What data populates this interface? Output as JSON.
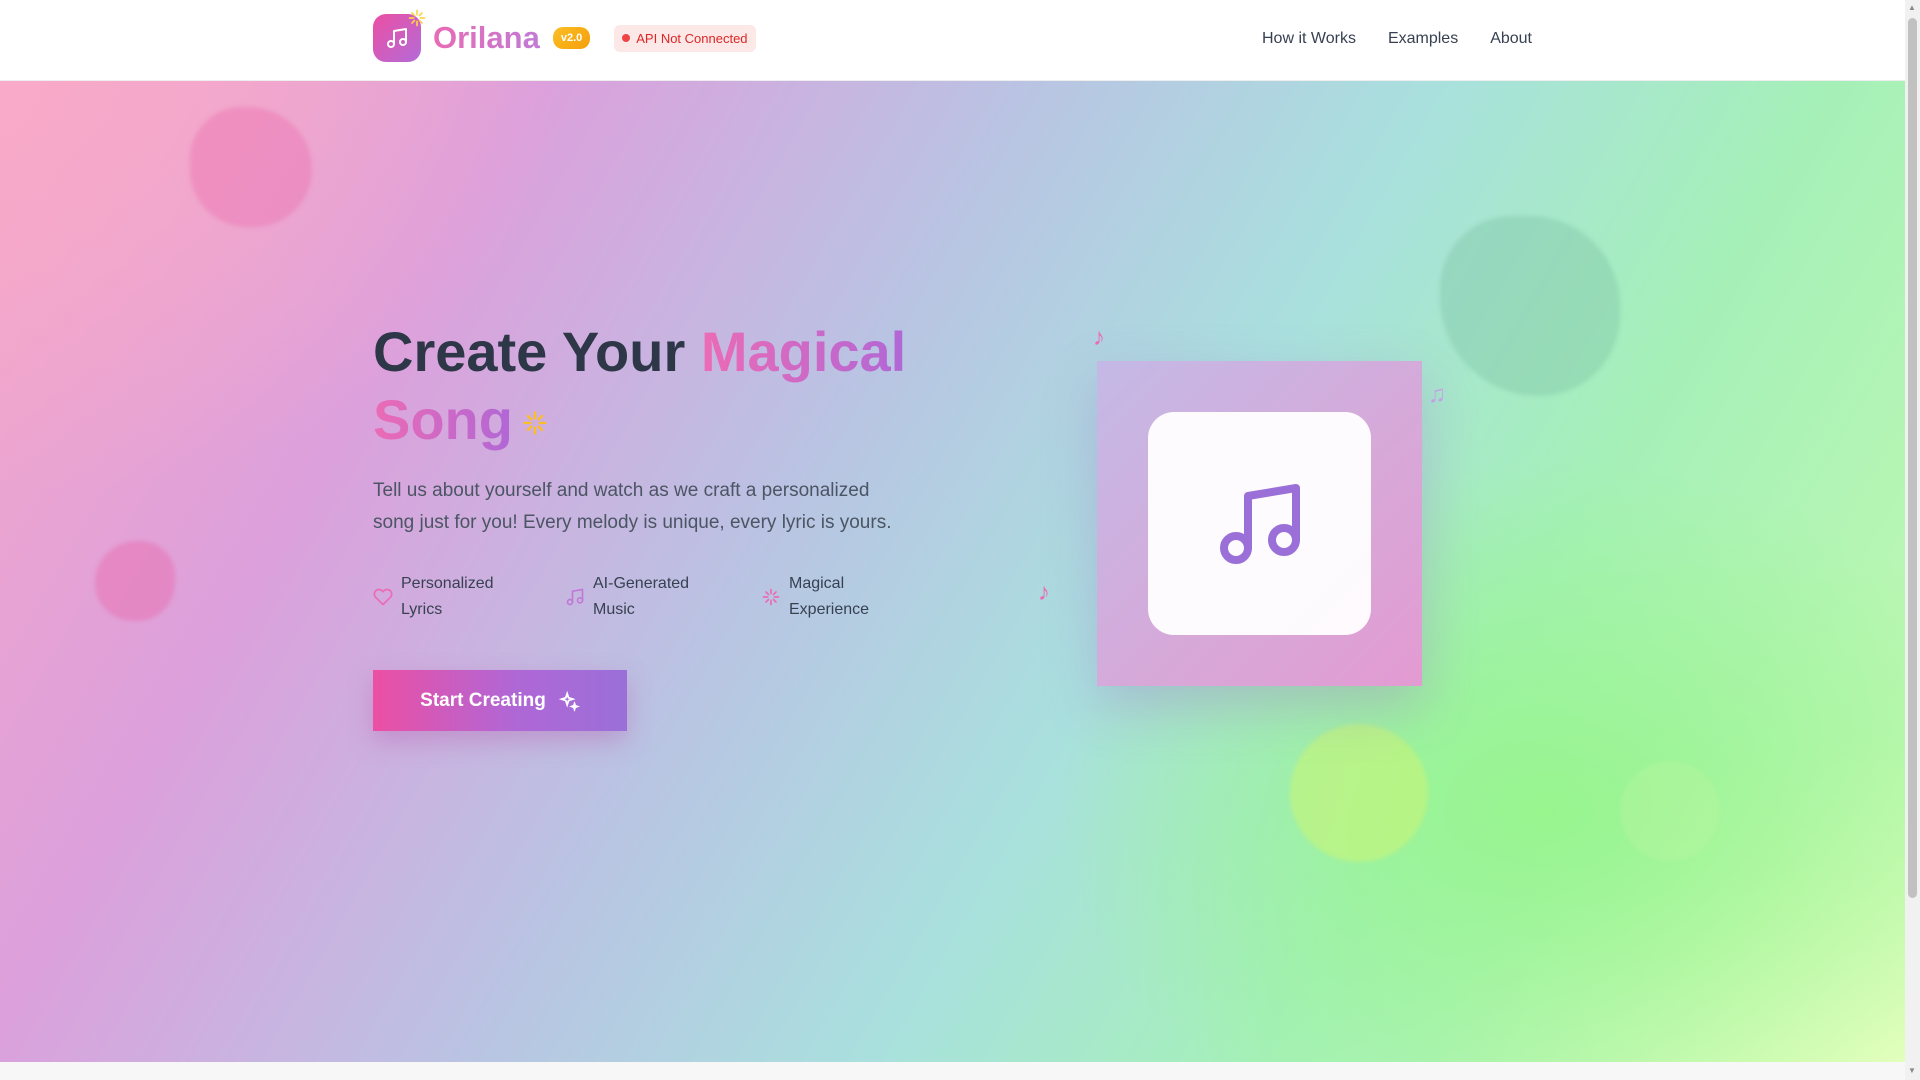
{
  "header": {
    "brand": "Orilana",
    "version": "v2.0",
    "api_status": "API Not Connected",
    "nav": [
      {
        "label": "How it Works"
      },
      {
        "label": "Examples"
      },
      {
        "label": "About"
      }
    ]
  },
  "hero": {
    "title_plain": "Create Your ",
    "title_accent_1": "Magical",
    "title_accent_2": "Song",
    "subtitle": "Tell us about yourself and watch as we craft a personalized song just for you! Every melody is unique, every lyric is yours.",
    "features": [
      {
        "icon": "heart-icon",
        "label": "Personalized Lyrics"
      },
      {
        "icon": "music-note-icon",
        "label": "AI-Generated Music"
      },
      {
        "icon": "sparkles-icon",
        "label": "Magical Experience"
      }
    ],
    "cta_label": "Start Creating",
    "floating_notes": [
      "♪",
      "♫",
      "♪"
    ]
  },
  "colors": {
    "brand_pink": "#ec4fa3",
    "brand_purple": "#b067d6",
    "version_badge": "#f59e0b",
    "error_red": "#dc2626"
  }
}
